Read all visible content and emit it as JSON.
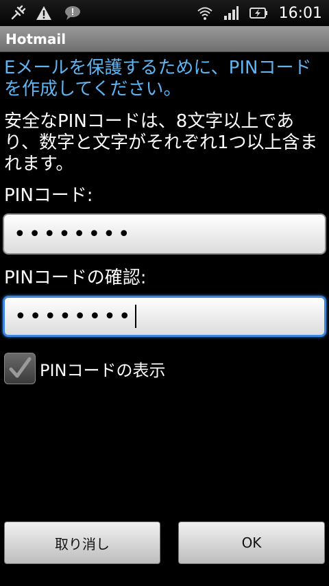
{
  "status_bar": {
    "time": "16:01",
    "icons": [
      "usb-debug-icon",
      "warning-icon",
      "chat-notification-icon",
      "wifi-icon",
      "signal-icon",
      "battery-charging-icon"
    ]
  },
  "app": {
    "title": "Hotmail"
  },
  "form": {
    "heading": "Eメールを保護するために、PINコードを作成してください。",
    "description": "安全なPINコードは、8文字以上であり、数字と文字がそれぞれ1つ以上含まれます。",
    "pin_label": "PINコード:",
    "pin_value": "••••••••",
    "confirm_label": "PINコードの確認:",
    "confirm_value": "••••••••",
    "show_pin_label": "PINコードの表示",
    "show_pin_checked": true
  },
  "buttons": {
    "cancel": "取り消し",
    "ok": "OK"
  },
  "colors": {
    "heading": "#5fb4f2",
    "focus": "#3b86e0",
    "background": "#000000"
  }
}
